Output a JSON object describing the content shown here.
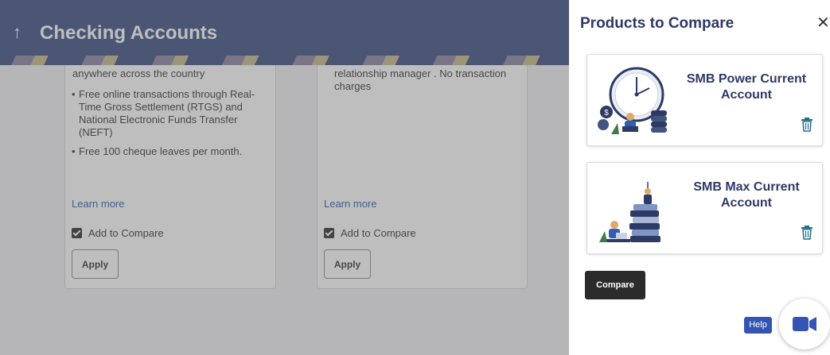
{
  "page": {
    "title": "Checking Accounts",
    "back_icon": "up-arrow-icon"
  },
  "cards": [
    {
      "desc_line": "anywhere across the country",
      "features": [
        "Free online transactions through Real-Time Gross Settlement (RTGS) and National Electronic Funds Transfer (NEFT)",
        "Free 100 cheque leaves per month."
      ],
      "learn_more": "Learn more",
      "compare_label": "Add to Compare",
      "compare_checked": true,
      "apply_label": "Apply"
    },
    {
      "desc_lines": [
        "relationship manager . No transaction",
        "charges"
      ],
      "learn_more": "Learn more",
      "compare_label": "Add to Compare",
      "compare_checked": true,
      "apply_label": "Apply"
    }
  ],
  "panel": {
    "title": "Products to Compare",
    "close_icon": "close-icon",
    "products": [
      {
        "name": "SMB Power Current Account",
        "image": "clock-and-coins-illustration",
        "remove_icon": "trash-icon"
      },
      {
        "name": "SMB Max Current Account",
        "image": "books-stack-illustration",
        "remove_icon": "trash-icon"
      }
    ],
    "compare_label": "Compare",
    "help_label": "Help",
    "video_icon": "video-camera-icon"
  },
  "colors": {
    "header_bg": "#3a4c80",
    "title_navy": "#2e3a66",
    "link_blue": "#2c5ea8",
    "dark_button": "#2b2b2b",
    "help_blue": "#3454b4",
    "icon_teal": "#1f6f8b"
  }
}
